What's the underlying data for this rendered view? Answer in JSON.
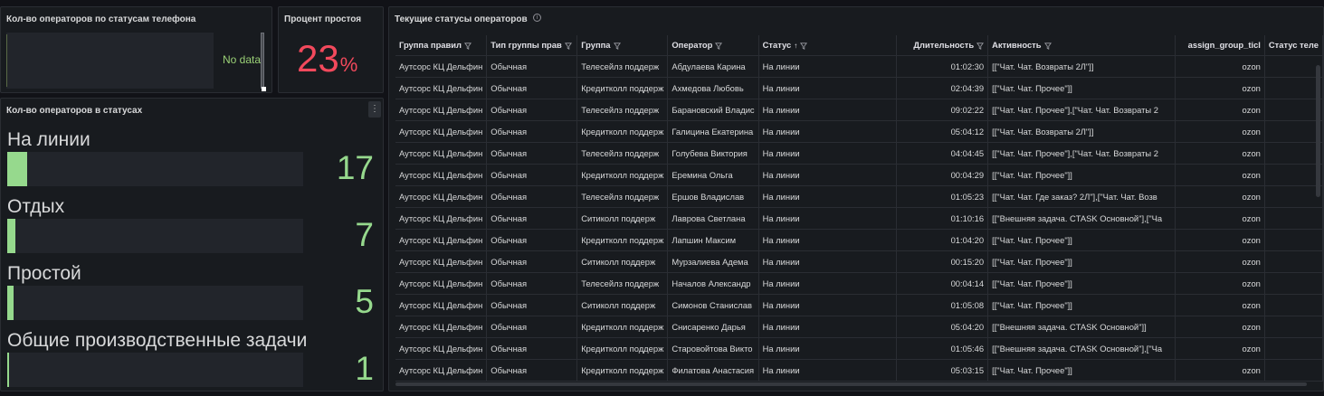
{
  "panels": {
    "phone_status": {
      "title": "Кол-во операторов по статусам телефона",
      "empty_text": "No data"
    },
    "idle_percent": {
      "title": "Процент простоя",
      "value": "23",
      "unit": "%",
      "color": "#f2495c"
    },
    "operator_counts": {
      "title": "Кол-во операторов в статусах",
      "max": 17,
      "rows": [
        {
          "label": "На линии",
          "value": 17,
          "display": "17"
        },
        {
          "label": "Отдых",
          "value": 7,
          "display": "7"
        },
        {
          "label": "Простой",
          "value": 5,
          "display": "5"
        },
        {
          "label": "Общие производственные задачи",
          "value": 1,
          "display": "1"
        }
      ],
      "bar_color": "#96d98d"
    },
    "current_statuses": {
      "title": "Текущие статусы операторов",
      "columns": [
        {
          "label": "Группа правил"
        },
        {
          "label": "Тип группы прав"
        },
        {
          "label": "Группа"
        },
        {
          "label": "Оператор"
        },
        {
          "label": "Статус",
          "sort": "↑"
        },
        {
          "label": "Длительность"
        },
        {
          "label": "Активность"
        },
        {
          "label": "assign_group_ticl"
        },
        {
          "label": "Статус теле"
        }
      ],
      "rows": [
        [
          "Аутсорс КЦ Дельфин",
          "Обычная",
          "Телесейлз поддерж",
          "Абдулаева Карина",
          "На линии",
          "01:02:30",
          "[[\"Чат. Чат. Возвраты 2Л\"]]",
          "ozon",
          ""
        ],
        [
          "Аутсорс КЦ Дельфин",
          "Обычная",
          "Кредитколл поддерж",
          "Ахмедова Любовь",
          "На линии",
          "02:04:39",
          "[[\"Чат. Чат. Прочее\"]]",
          "ozon",
          ""
        ],
        [
          "Аутсорс КЦ Дельфин",
          "Обычная",
          "Телесейлз поддерж",
          "Барановский Владис",
          "На линии",
          "09:02:22",
          "[[\"Чат. Чат. Прочее\"],[\"Чат. Чат. Возвраты 2",
          "ozon",
          ""
        ],
        [
          "Аутсорс КЦ Дельфин",
          "Обычная",
          "Кредитколл поддерж",
          "Галицина Екатерина",
          "На линии",
          "05:04:12",
          "[[\"Чат. Чат. Возвраты 2Л\"]]",
          "ozon",
          ""
        ],
        [
          "Аутсорс КЦ Дельфин",
          "Обычная",
          "Телесейлз поддерж",
          "Голубева Виктория",
          "На линии",
          "04:04:45",
          "[[\"Чат. Чат. Прочее\"],[\"Чат. Чат. Возвраты 2",
          "ozon",
          ""
        ],
        [
          "Аутсорс КЦ Дельфин",
          "Обычная",
          "Кредитколл поддерж",
          "Еремина Ольга",
          "На линии",
          "00:04:29",
          "[[\"Чат. Чат. Прочее\"]]",
          "ozon",
          ""
        ],
        [
          "Аутсорс КЦ Дельфин",
          "Обычная",
          "Телесейлз поддерж",
          "Ершов Владислав",
          "На линии",
          "01:05:23",
          "[[\"Чат. Чат. Где заказ? 2Л\"],[\"Чат. Чат. Возв",
          "ozon",
          ""
        ],
        [
          "Аутсорс КЦ Дельфин",
          "Обычная",
          "Ситиколл поддерж",
          "Лаврова Светлана",
          "На линии",
          "01:10:16",
          "[[\"Внешняя задача. CTASK Основной\"],[\"Ча",
          "ozon",
          ""
        ],
        [
          "Аутсорс КЦ Дельфин",
          "Обычная",
          "Кредитколл поддерж",
          "Лапшин Максим",
          "На линии",
          "01:04:20",
          "[[\"Чат. Чат. Прочее\"]]",
          "ozon",
          ""
        ],
        [
          "Аутсорс КЦ Дельфин",
          "Обычная",
          "Ситиколл поддерж",
          "Мурзалиева Адема",
          "На линии",
          "00:15:20",
          "[[\"Чат. Чат. Прочее\"]]",
          "ozon",
          ""
        ],
        [
          "Аутсорс КЦ Дельфин",
          "Обычная",
          "Телесейлз поддерж",
          "Началов Александр",
          "На линии",
          "00:04:14",
          "[[\"Чат. Чат. Прочее\"]]",
          "ozon",
          ""
        ],
        [
          "Аутсорс КЦ Дельфин",
          "Обычная",
          "Ситиколл поддерж",
          "Симонов Станислав",
          "На линии",
          "01:05:08",
          "[[\"Чат. Чат. Прочее\"]]",
          "ozon",
          ""
        ],
        [
          "Аутсорс КЦ Дельфин",
          "Обычная",
          "Кредитколл поддерж",
          "Снисаренко Дарья",
          "На линии",
          "05:04:20",
          "[[\"Внешняя задача. CTASK Основной\"]]",
          "ozon",
          ""
        ],
        [
          "Аутсорс КЦ Дельфин",
          "Обычная",
          "Кредитколл поддерж",
          "Старовойтова Викто",
          "На линии",
          "01:05:46",
          "[[\"Внешняя задача. CTASK Основной\"],[\"Ча",
          "ozon",
          ""
        ],
        [
          "Аутсорс КЦ Дельфин",
          "Обычная",
          "Кредитколл поддерж",
          "Филатова Анастасия",
          "На линии",
          "05:03:15",
          "[[\"Чат. Чат. Прочее\"]]",
          "ozon",
          ""
        ]
      ]
    }
  }
}
